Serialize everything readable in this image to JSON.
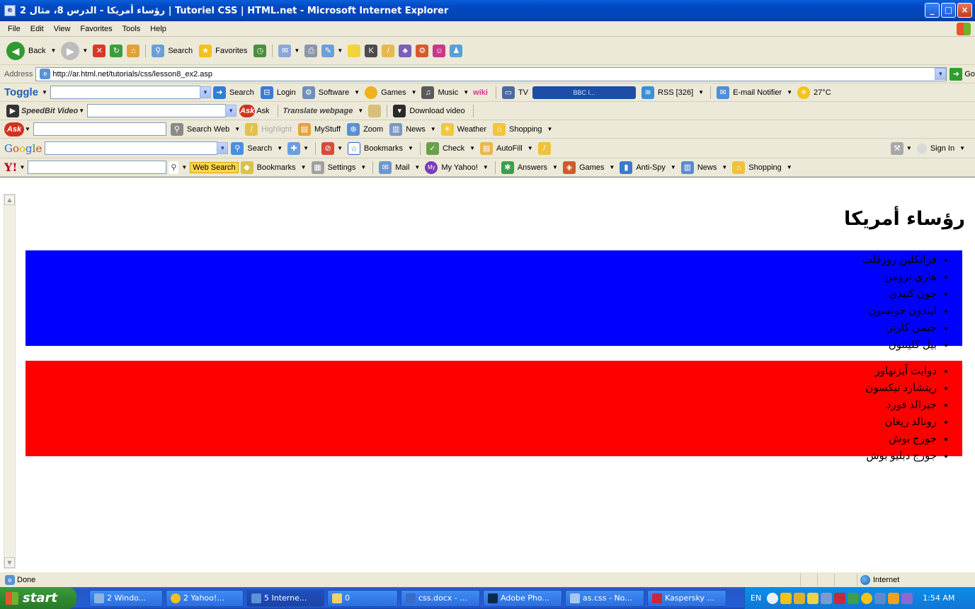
{
  "window": {
    "title": "رؤساء أمريكا - الدرس 8، مثال 2 | Tutoriel CSS | HTML.net - Microsoft Internet Explorer",
    "buttons": [
      "_",
      "□",
      "×"
    ]
  },
  "menu": [
    "File",
    "Edit",
    "View",
    "Favorites",
    "Tools",
    "Help"
  ],
  "standard_toolbar": {
    "back": "Back",
    "search": "Search",
    "favorites": "Favorites"
  },
  "address_bar": {
    "label": "Address",
    "url": "http://ar.html.net/tutorials/css/lesson8_ex2.asp",
    "go": "Go"
  },
  "toggle_toolbar": {
    "brand": "Toggle",
    "search": "Search",
    "login": "Login",
    "software": "Software",
    "games": "Games",
    "music": "Music",
    "wiki": "wiki",
    "tv": "TV",
    "player": "BBC I...",
    "rss": "RSS [326]",
    "email": "E-mail Notifier",
    "temp": "27°C"
  },
  "speedbit_toolbar": {
    "brand": "SpeedBit Video",
    "ask": "Ask",
    "translate": "Translate webpage",
    "download": "Download video"
  },
  "ask_toolbar": {
    "logo": "Ask",
    "search_web": "Search Web",
    "highlight": "Highlight",
    "mystuff": "MyStuff",
    "zoom": "Zoom",
    "news": "News",
    "weather": "Weather",
    "shopping": "Shopping"
  },
  "google_toolbar": {
    "search": "Search",
    "bookmarks": "Bookmarks",
    "check": "Check",
    "autofill": "AutoFill",
    "signin": "Sign In"
  },
  "yahoo_toolbar": {
    "logo": "Y!",
    "web_search": "Web Search",
    "bookmarks": "Bookmarks",
    "settings": "Settings",
    "mail": "Mail",
    "myyahoo": "My Yahoo!",
    "answers": "Answers",
    "games": "Games",
    "antispy": "Anti-Spy",
    "news": "News",
    "shopping": "Shopping"
  },
  "page": {
    "heading": "رؤساء أمريكا",
    "blue_list": [
      "فرانكلين روزفلت",
      "هاري ترومن",
      "جون كنيدي",
      "ليندون جونسون",
      "جيمي كارتر",
      "بيل كلينتون"
    ],
    "red_list": [
      "دوايت آيزنهاور",
      "ريتشارد نيكسون",
      "جيرالد فورد",
      "رونالد ريغان",
      "جورج بوش",
      "جورج دبليو بوش"
    ],
    "colors": {
      "blue_box": "#0000ff",
      "red_box": "#ff0000"
    }
  },
  "status_bar": {
    "left": "Done",
    "zone": "Internet"
  },
  "taskbar": {
    "start": "start",
    "tasks": [
      "2 Windo...",
      "2 Yahoo!...",
      "5 Interne...",
      "0",
      "css.docx - ...",
      "Adobe Pho...",
      "as.css - No...",
      "Kaspersky ..."
    ],
    "lang": "EN",
    "clock": "1:54 AM"
  }
}
